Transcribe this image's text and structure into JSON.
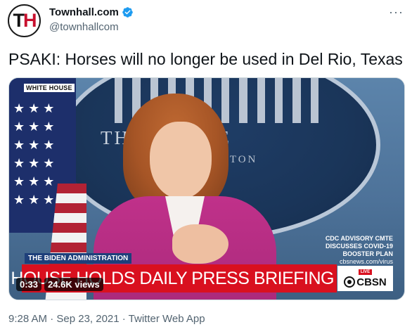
{
  "author": {
    "avatar_text": "TH",
    "display_name": "Townhall.com",
    "handle": "@townhallcom",
    "verified": true
  },
  "more_icon": "more-dots-icon",
  "tweet": {
    "text": "PSAKI: Horses will no longer be used in Del Rio, Texas"
  },
  "video": {
    "corner_tag": "WHITE HOUSE",
    "backdrop_text_big": "TH        E HOUSE",
    "backdrop_text_small": "GTON",
    "lower_third_tag": "THE BIDEN ADMINISTRATION",
    "headline": "WHITE HOUSE HOLDS DAILY PRESS BRIEFING",
    "side_note": [
      "CDC ADVISORY CMTE",
      "DISCUSSES COVID-19",
      "BOOSTER PLAN"
    ],
    "side_url": "cbsnews.com/virus",
    "network_live": "LIVE",
    "network": "CBSN",
    "duration": "0:33",
    "views": "24.6K views"
  },
  "meta": {
    "timestamp": "9:28 AM · Sep 23, 2021 · Twitter Web App"
  },
  "colors": {
    "verified_blue": "#1d9bf0",
    "banner_red": "#d9101f",
    "secondary_text": "#536471"
  }
}
